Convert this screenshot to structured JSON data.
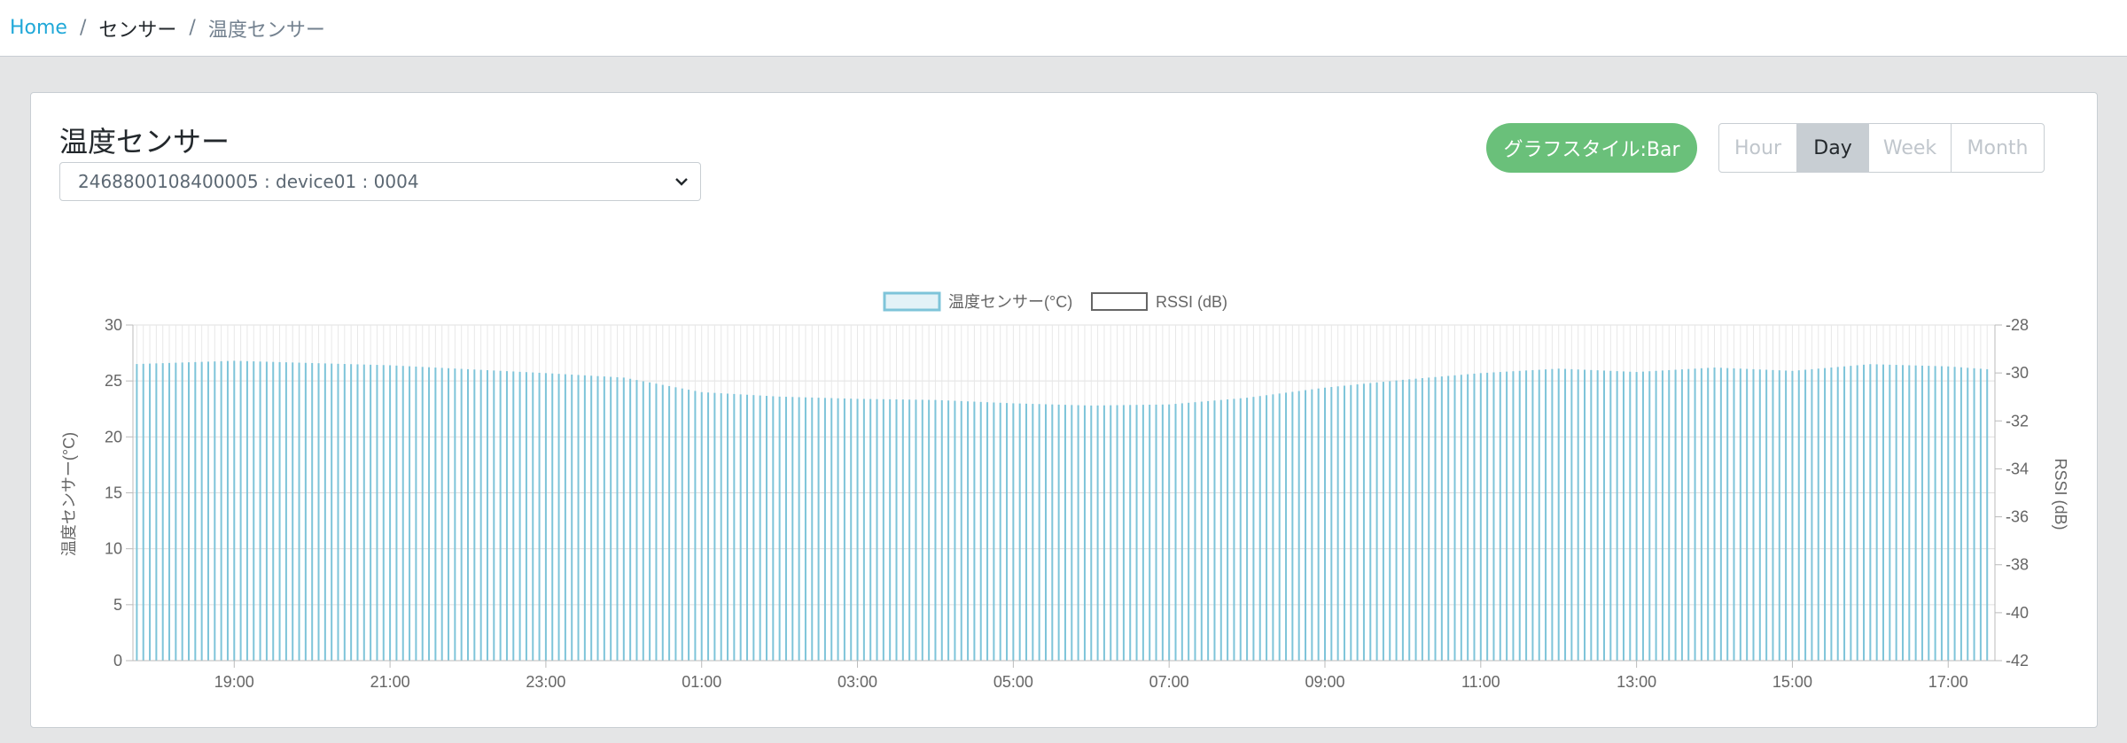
{
  "breadcrumb": {
    "home": "Home",
    "sensor": "センサー",
    "current": "温度センサー"
  },
  "card": {
    "title": "温度センサー",
    "device_select_value": "2468800108400005 : device01 : 0004",
    "graph_style_label": "グラフスタイル:Bar",
    "ranges": {
      "hour": "Hour",
      "day": "Day",
      "week": "Week",
      "month": "Month"
    },
    "active_range": "Day"
  },
  "colors": {
    "accent": "#20a8d8",
    "success": "#6ac07a",
    "temp_bar": "#7ec4d9",
    "rssi_bar": "#e8e8e8"
  },
  "icons": {
    "select": "chevron-down-icon"
  },
  "chart_data": {
    "type": "bar",
    "title": "",
    "legend": [
      "温度センサー(°C)",
      "RSSI (dB)"
    ],
    "legend_position": "top",
    "ylabel": "温度センサー(°C)",
    "y2label": "RSSI (dB)",
    "ylim": [
      0,
      30
    ],
    "y2lim": [
      -42,
      -28
    ],
    "yticks": [
      "0",
      "5",
      "10",
      "15",
      "20",
      "25",
      "30"
    ],
    "y2ticks": [
      "-42",
      "-40",
      "-38",
      "-36",
      "-34",
      "-32",
      "-30",
      "-28"
    ],
    "xticks": [
      "19:00",
      "21:00",
      "23:00",
      "01:00",
      "03:00",
      "05:00",
      "07:00",
      "09:00",
      "11:00",
      "13:00",
      "15:00",
      "17:00"
    ],
    "x_start_hour": 17.7,
    "x_end_hour": 41.6,
    "temp_series": {
      "name": "温度センサー(°C)",
      "keyframes": [
        [
          17.7,
          26.5
        ],
        [
          19.0,
          26.8
        ],
        [
          21.0,
          26.4
        ],
        [
          23.0,
          25.7
        ],
        [
          0.0,
          25.3
        ],
        [
          1.0,
          24.0
        ],
        [
          2.0,
          23.6
        ],
        [
          3.0,
          23.4
        ],
        [
          4.0,
          23.3
        ],
        [
          5.0,
          23.0
        ],
        [
          6.0,
          22.8
        ],
        [
          7.0,
          22.9
        ],
        [
          8.0,
          23.5
        ],
        [
          9.0,
          24.4
        ],
        [
          10.0,
          25.1
        ],
        [
          11.0,
          25.7
        ],
        [
          12.0,
          26.1
        ],
        [
          13.0,
          25.8
        ],
        [
          14.0,
          26.2
        ],
        [
          15.0,
          25.9
        ],
        [
          16.0,
          26.5
        ],
        [
          17.0,
          26.3
        ],
        [
          17.6,
          26.0
        ]
      ]
    },
    "rssi_series": {
      "name": "RSSI (dB)",
      "typical": -29.0
    }
  }
}
